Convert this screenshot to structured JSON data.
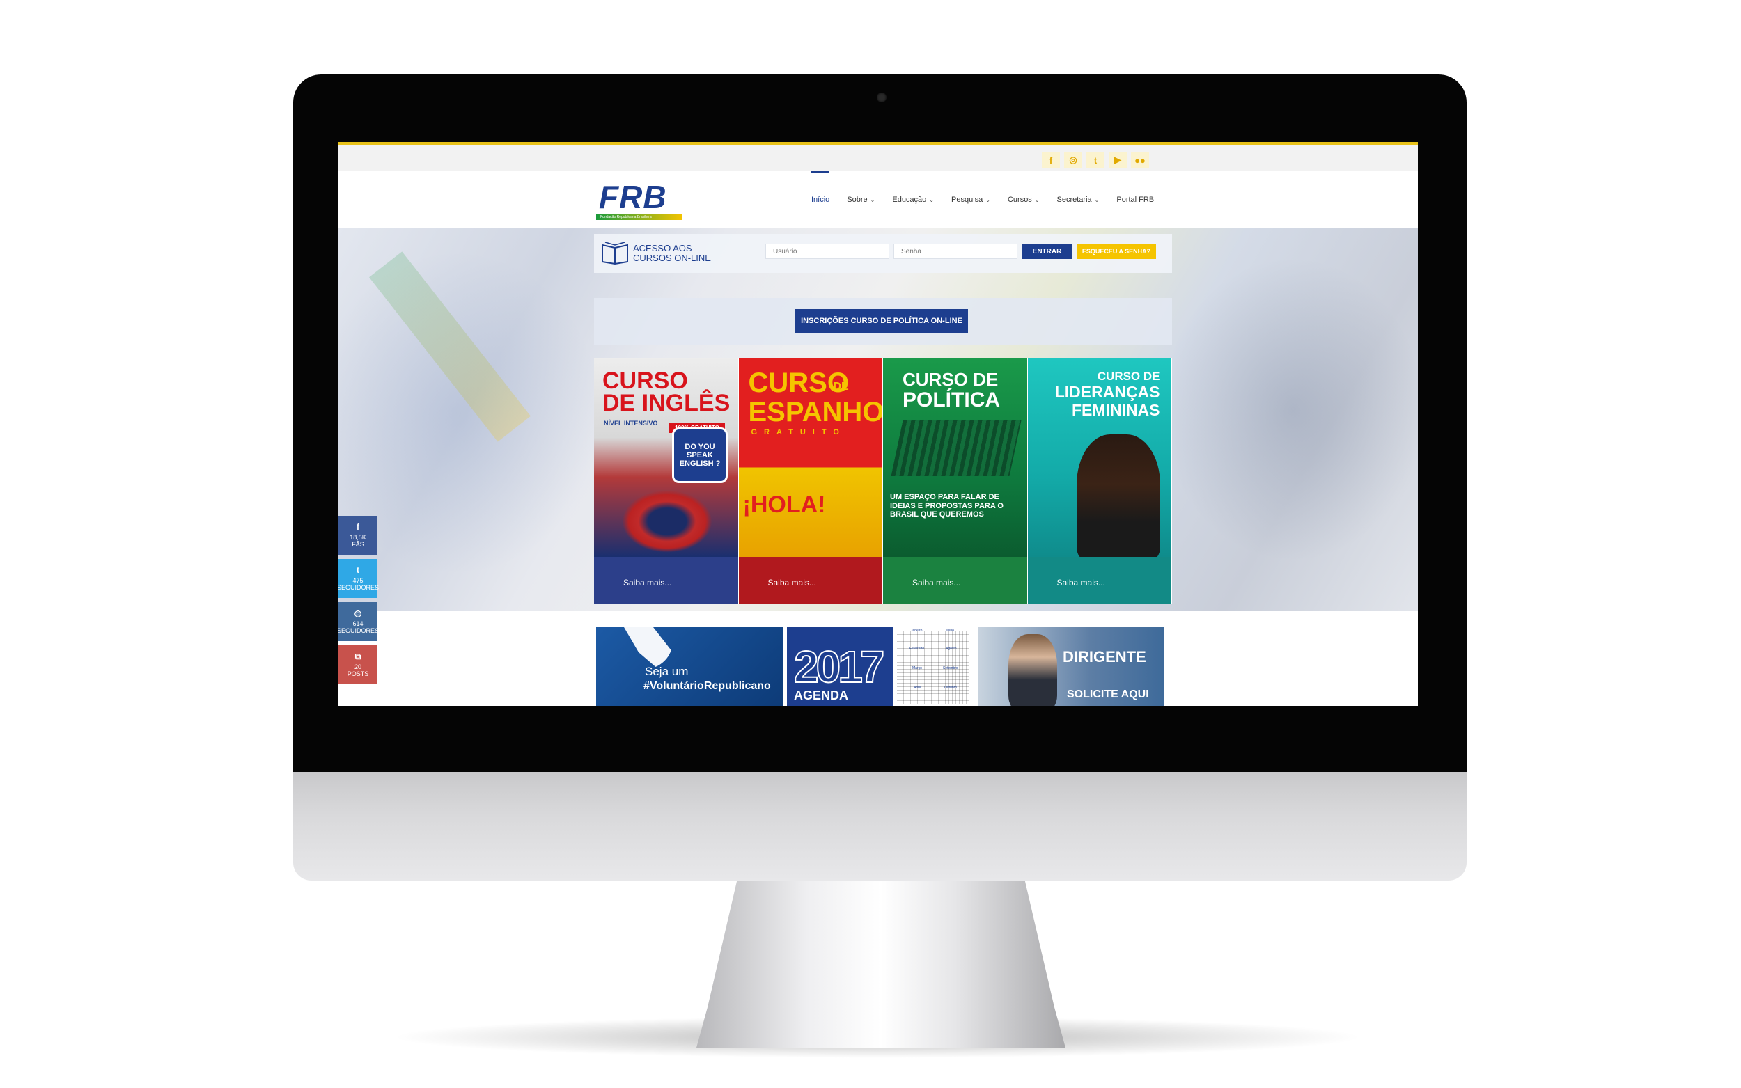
{
  "top_social": [
    "f",
    "◎",
    "t",
    "▶",
    "●●"
  ],
  "logo": {
    "text": "FRB",
    "subtitle": "Fundação Republicana Brasileira"
  },
  "nav": [
    {
      "label": "Início",
      "dropdown": false,
      "active": true
    },
    {
      "label": "Sobre",
      "dropdown": true
    },
    {
      "label": "Educação",
      "dropdown": true
    },
    {
      "label": "Pesquisa",
      "dropdown": true
    },
    {
      "label": "Cursos",
      "dropdown": true
    },
    {
      "label": "Secretaria",
      "dropdown": true
    },
    {
      "label": "Portal FRB",
      "dropdown": false
    }
  ],
  "login": {
    "title_line1": "ACESSO AOS",
    "title_line2": "CURSOS ON-LINE",
    "username_placeholder": "Usuário",
    "password_placeholder": "Senha",
    "submit": "ENTRAR",
    "forgot": "ESQUECEU A SENHA?"
  },
  "inscricoes_button": "INSCRIÇÕES CURSO DE POLÍTICA ON-LINE",
  "courses": [
    {
      "line1": "CURSO",
      "line2": "DE INGLÊS",
      "line3": "NÍVEL INTENSIVO",
      "badge_top": "100% GRATUITO",
      "badge": "DO YOU SPEAK ENGLISH ?",
      "link": "Saiba mais..."
    },
    {
      "line1": "CURSO",
      "line1b": "DE",
      "line2": "ESPANHOL",
      "line3": "GRATUITO",
      "line4": "¡HOLA!",
      "link": "Saiba mais..."
    },
    {
      "line1": "CURSO DE",
      "line2": "POLÍTICA",
      "line3": "UM ESPAÇO PARA FALAR DE IDEIAS E PROPOSTAS PARA O BRASIL QUE QUEREMOS",
      "link": "Saiba mais..."
    },
    {
      "line1": "CURSO DE",
      "line2": "LIDERANÇAS",
      "line3": "FEMININAS",
      "link": "Saiba mais..."
    }
  ],
  "side_social": [
    {
      "icon": "f",
      "count": "18,5K",
      "label": "FÃS"
    },
    {
      "icon": "t",
      "count": "475",
      "label": "SEGUIDORES"
    },
    {
      "icon": "◎",
      "count": "614",
      "label": "SEGUIDORES"
    },
    {
      "icon": "⧉",
      "count": "20",
      "label": "POSTS"
    }
  ],
  "banners": {
    "volunteer_line1": "Seja um",
    "volunteer_line2": "#VoluntárioRepublicano",
    "agenda_year": "2017",
    "agenda_label": "AGENDA",
    "calendar_months": [
      "Janeiro",
      "Julho",
      "Fevereiro",
      "Agosto",
      "Março",
      "Setembro",
      "Abril",
      "Outubro"
    ],
    "dirigente_line1": "DIRIGENTE",
    "dirigente_line2": "SOLICITE AQUI"
  },
  "colors": {
    "brand_blue": "#1d3e8f",
    "brand_yellow": "#f5c400",
    "brand_green": "#1a9b3c"
  }
}
